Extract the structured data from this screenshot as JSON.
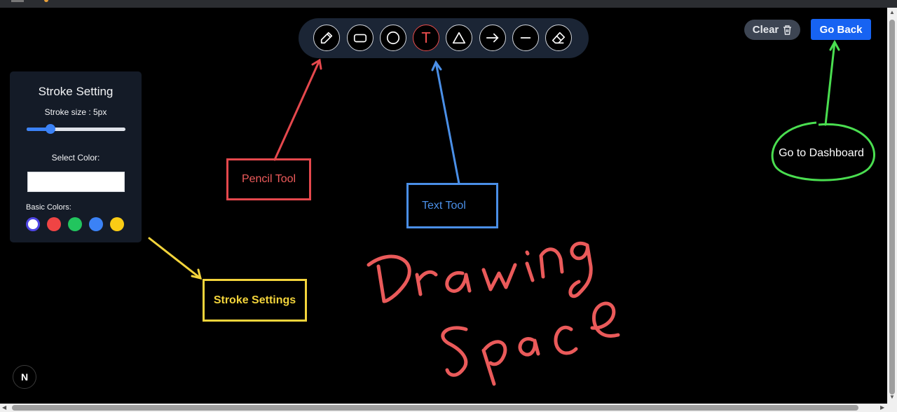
{
  "toolbar": {
    "tools": [
      {
        "name": "pencil-icon",
        "active": false
      },
      {
        "name": "rectangle-icon",
        "active": false
      },
      {
        "name": "circle-icon",
        "active": false
      },
      {
        "name": "text-icon",
        "active": true
      },
      {
        "name": "triangle-icon",
        "active": false
      },
      {
        "name": "arrow-icon",
        "active": false
      },
      {
        "name": "line-icon",
        "active": false
      },
      {
        "name": "eraser-icon",
        "active": false
      }
    ],
    "text_tool_glyph": "T"
  },
  "actions": {
    "clear_label": "Clear",
    "back_label": "Go Back"
  },
  "panel": {
    "title": "Stroke Setting",
    "stroke_label": "Stroke size : 5px",
    "stroke_fraction": 0.24,
    "color_label": "Select Color:",
    "selected_color": "#ffffff",
    "basic_label": "Basic Colors:",
    "basic_colors": [
      "#ffffff",
      "#ef4444",
      "#22c55e",
      "#3b82f6",
      "#facc15"
    ]
  },
  "annotations": {
    "pencil": "Pencil Tool",
    "text": "Text Tool",
    "stroke": "Stroke Settings",
    "dashboard": "Go to Dashboard"
  },
  "logo_letter": "N",
  "colors": {
    "red": "#e5484d",
    "blue": "#4a8fe7",
    "yellow": "#f3d43b",
    "green": "#4ade50",
    "accent": "#1763f2"
  }
}
